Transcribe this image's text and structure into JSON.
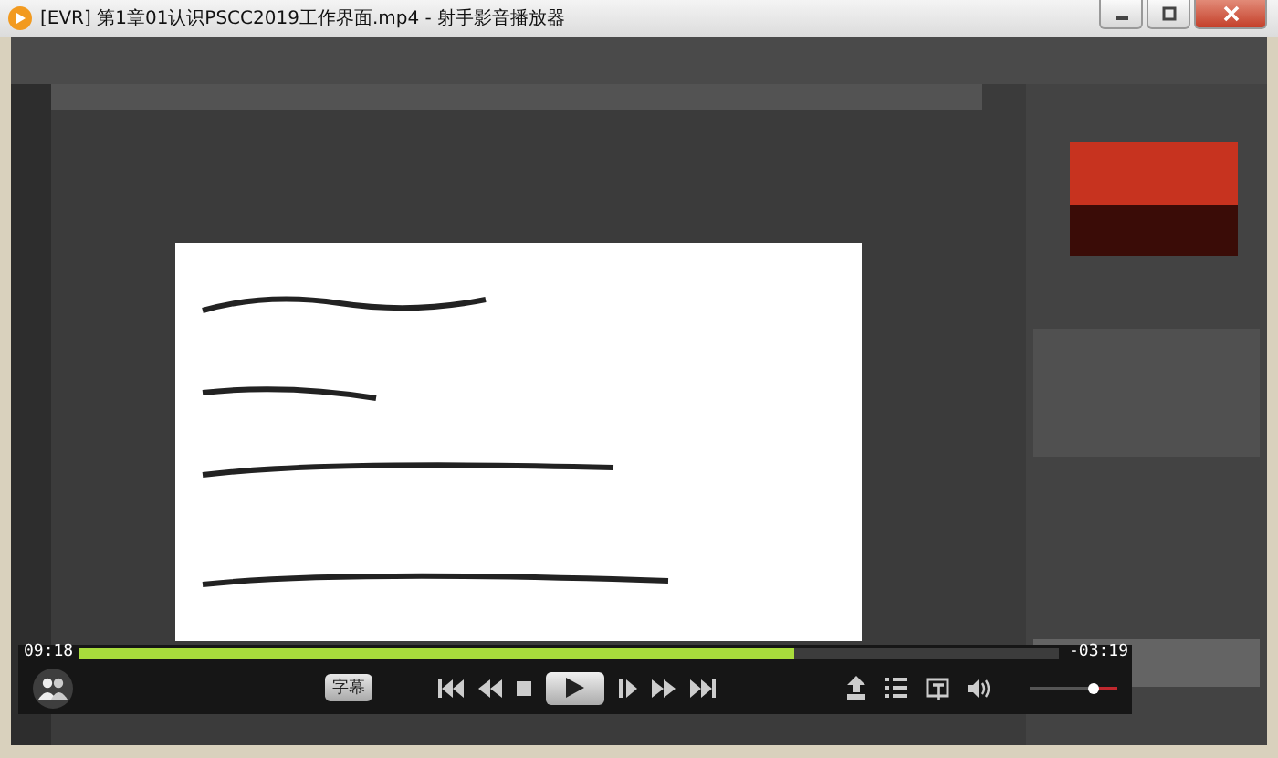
{
  "window": {
    "title": "[EVR] 第1章01认识PSCC2019工作界面.mp4 - 射手影音播放器"
  },
  "player": {
    "elapsed": "09:18",
    "remaining": "-03:19",
    "progress": {
      "level": 0.73
    },
    "subtitle_button": "字幕",
    "playing": false,
    "volume": {
      "level": 0.72
    }
  }
}
